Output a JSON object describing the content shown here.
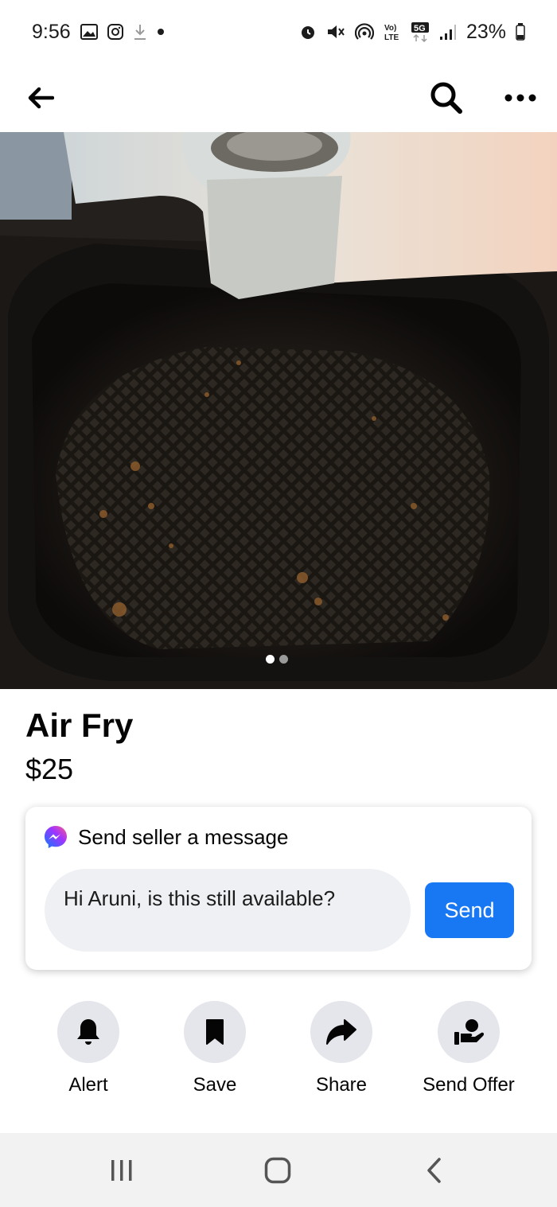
{
  "status_bar": {
    "time": "9:56",
    "battery": "23%",
    "network": "5G",
    "icons": [
      "gallery-icon",
      "instagram-icon",
      "download-icon",
      "dot-icon",
      "alarm-icon",
      "mute-icon",
      "hotspot-icon",
      "volte-icon",
      "signal-icon",
      "battery-icon"
    ]
  },
  "top_bar": {
    "icons": [
      "back-arrow-icon",
      "search-icon",
      "more-icon"
    ]
  },
  "listing": {
    "image": {
      "page_count": 2,
      "current_page": 1
    },
    "title": "Air Fry",
    "price": "$25"
  },
  "message_card": {
    "heading": "Send seller a message",
    "message_text": "Hi Aruni, is this still available?",
    "send_label": "Send"
  },
  "actions": [
    {
      "label": "Alert",
      "icon": "bell-icon"
    },
    {
      "label": "Save",
      "icon": "bookmark-icon"
    },
    {
      "label": "Share",
      "icon": "share-icon"
    },
    {
      "label": "Send Offer",
      "icon": "offer-icon"
    }
  ],
  "colors": {
    "accent": "#1877f2",
    "action_circle": "#e4e6eb",
    "input_bg": "#eef0f3"
  }
}
